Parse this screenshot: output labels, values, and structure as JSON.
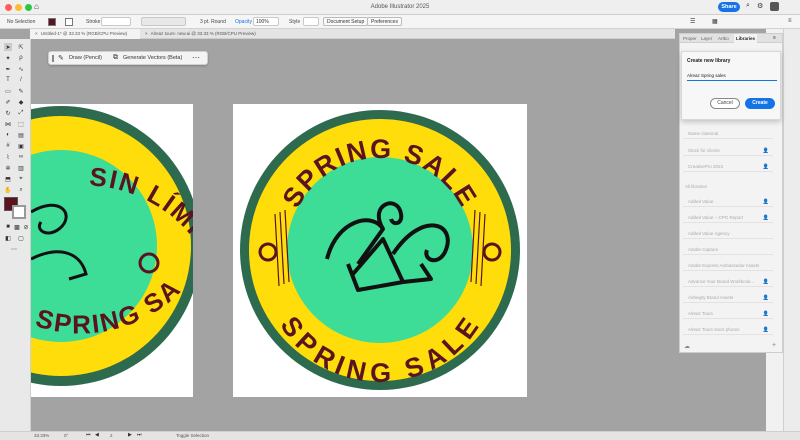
{
  "window": {
    "title": "Adobe Illustrator 2025",
    "share": "Share"
  },
  "control_bar": {
    "selection": "No Selection",
    "stroke_label": "Stroke",
    "stroke_style": "3 pt. Round",
    "opacity_label": "Opacity",
    "opacity_value": "100%",
    "style_label": "Style",
    "document_setup": "Document Setup",
    "preferences": "Preferences"
  },
  "tabs": [
    {
      "label": "Untitled-1* @ 33.33 % (RGB/CPU Preview)",
      "active": true
    },
    {
      "label": "Alreaz tours- new.ai @ 33.33 % (RGB/CPU Preview)",
      "active": false
    }
  ],
  "context_bar": {
    "draw": "Draw (Pencil)",
    "generate": "Generate Vectors (Beta)"
  },
  "artwork": {
    "badge_text_top": "SPRING SALE",
    "badge_text_bottom": "SPRING SALE",
    "left_badge_top": "SIN LÍMITES",
    "left_badge_bottom": "SPRING SALE",
    "colors": {
      "ring": "#2e6b4e",
      "yellow": "#ffdd0a",
      "center": "#3ddc97",
      "text": "#5a1420"
    }
  },
  "panel": {
    "tabs": [
      "Proper",
      "Layer",
      "Artbo",
      "Libraries"
    ],
    "active_tab": "Libraries",
    "dialog": {
      "title": "Create new library",
      "input_value": "Alreaz Spring sales",
      "cancel": "Cancel",
      "create": "Create"
    },
    "my_libraries": [
      "Name classical",
      "Stock for clients",
      "CreativePro 2023"
    ],
    "all_libraries_header": "All libraries",
    "all_libraries": [
      "Added Value",
      "Added Value – CPG Report",
      "Added Value Agency",
      "Adobe Capture",
      "Adobe Express Ambassador Assets",
      "Advance Your Brand Workbook...",
      "Airbegity Brand Assets",
      "Alreaz Tours",
      "Alreaz Tours stock photos"
    ]
  },
  "status_bar": {
    "zoom": "33.33%",
    "rotation": "0°",
    "artboard": "2",
    "tool": "Toggle Selection"
  }
}
